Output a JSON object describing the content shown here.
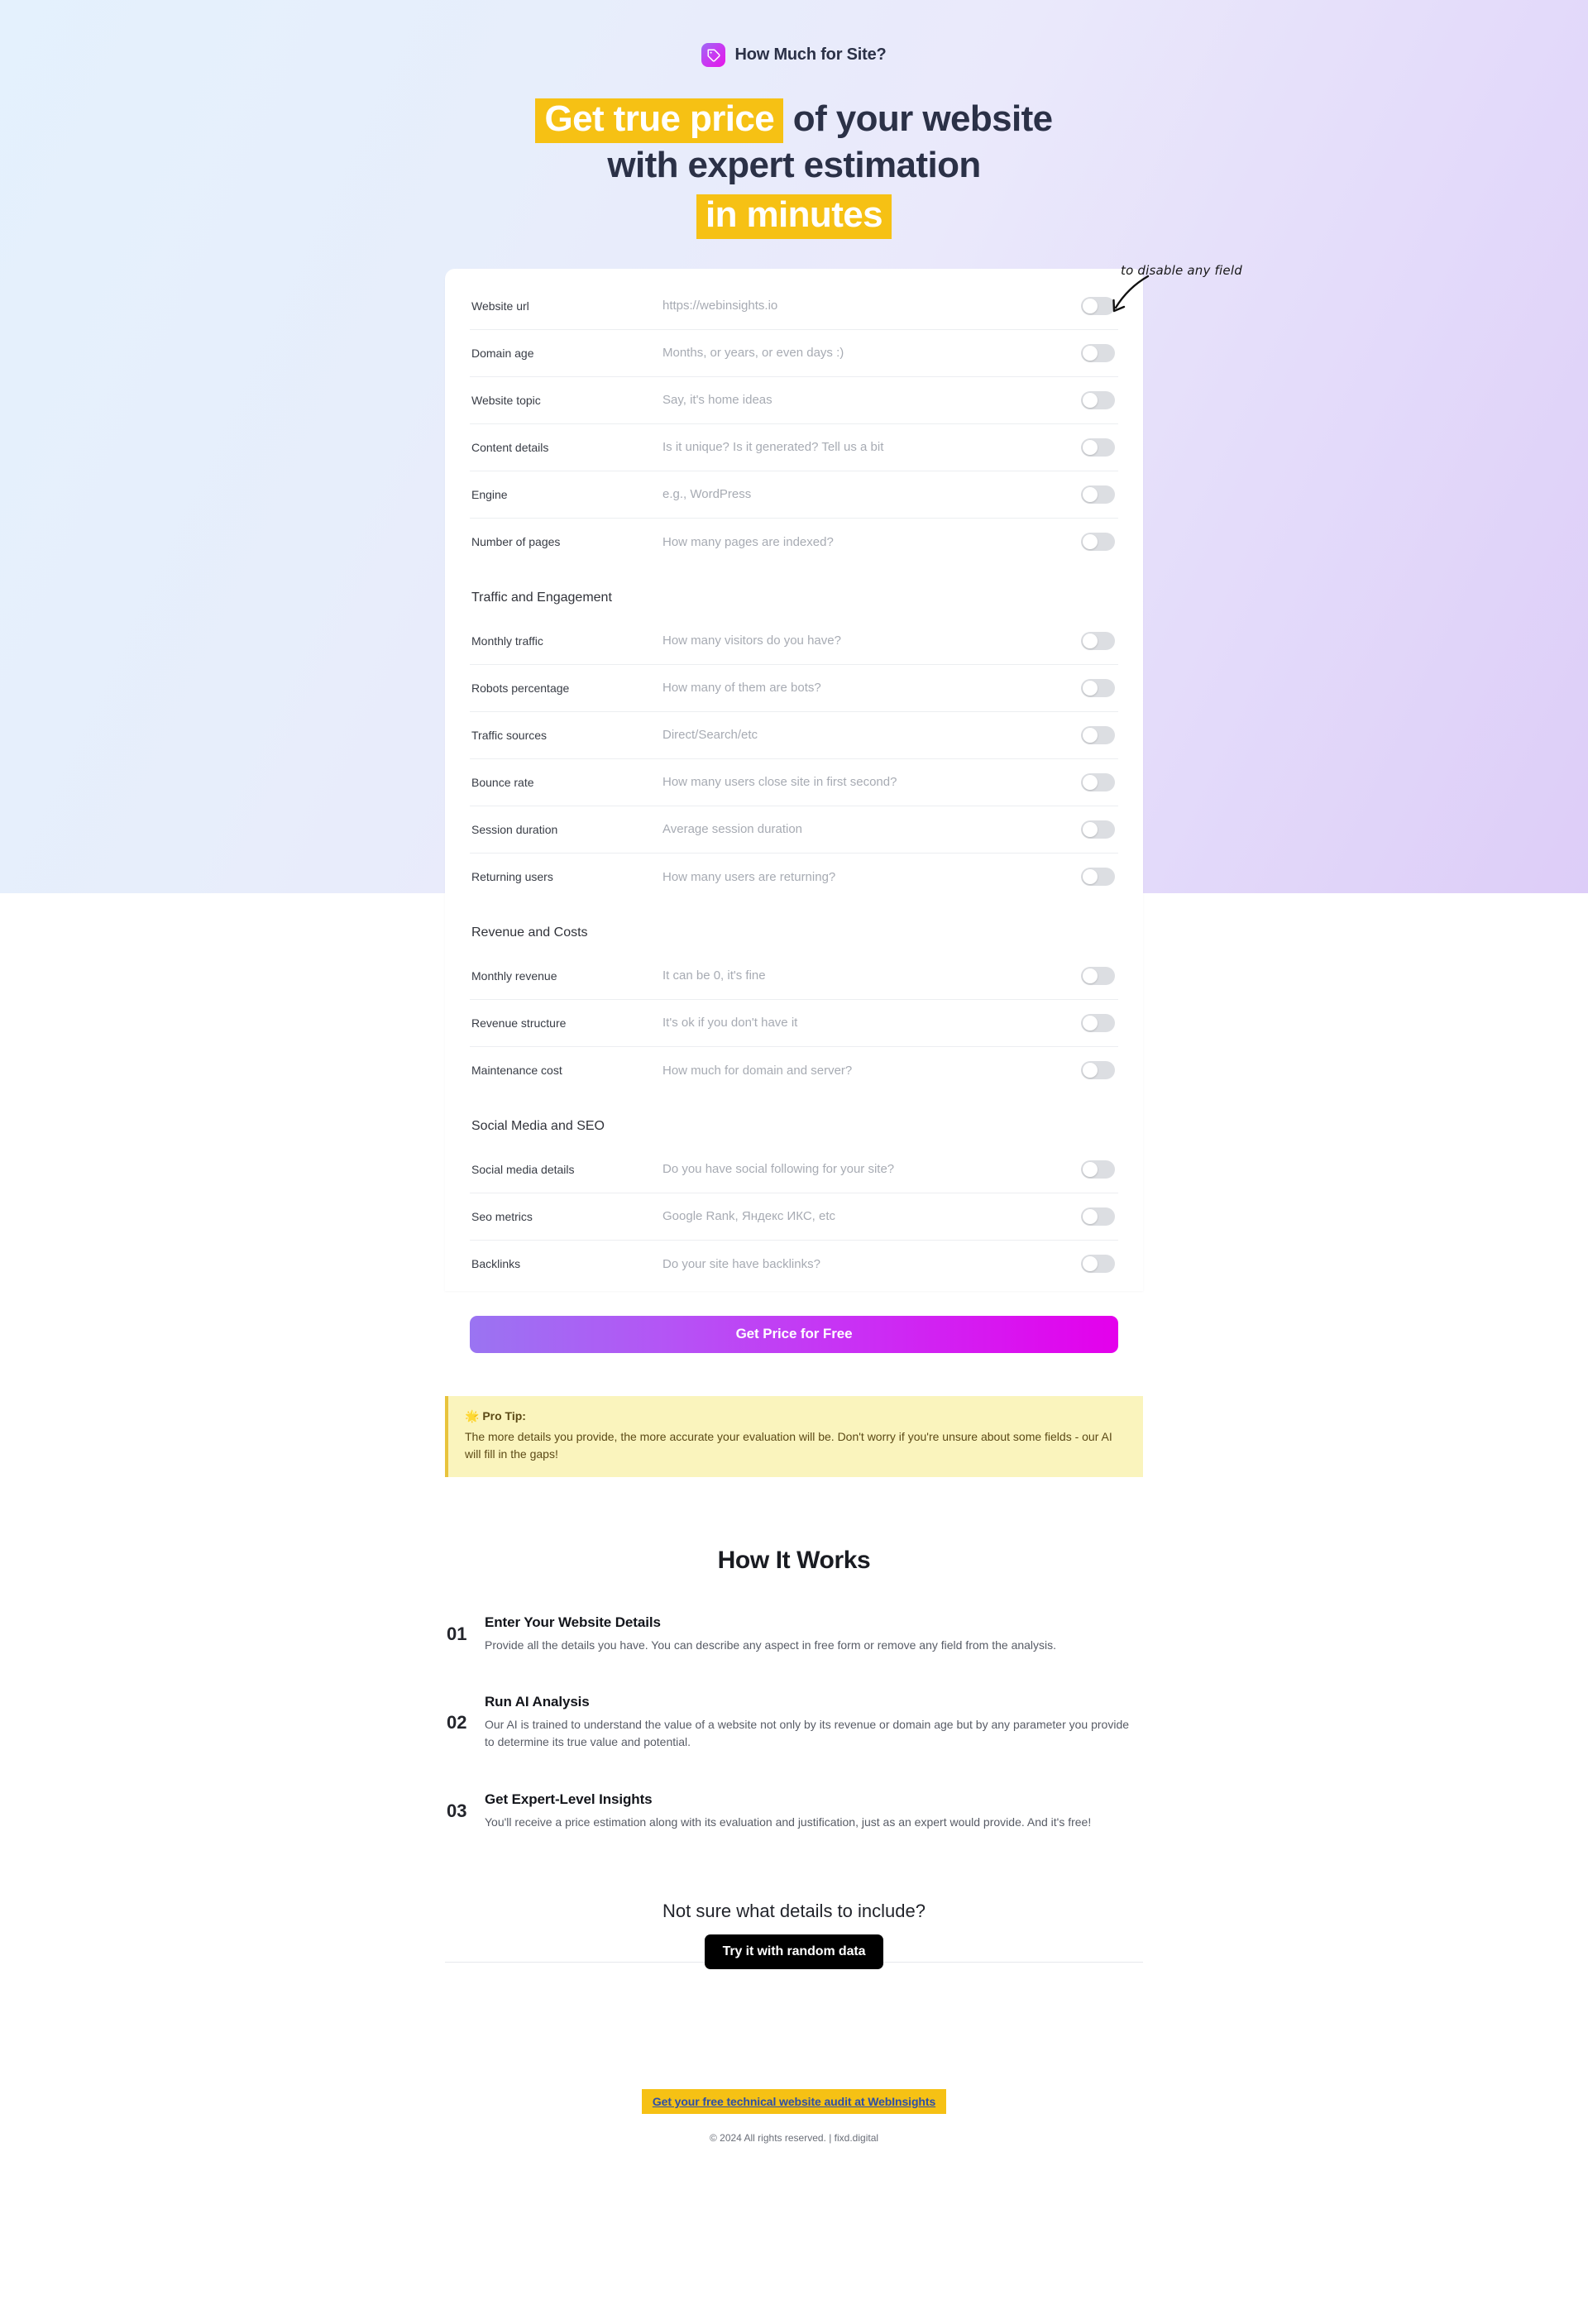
{
  "brand": {
    "name": "How Much for Site?",
    "logo_icon": "price-tag-icon"
  },
  "headline": {
    "part1": "Get true price",
    "part2": " of your website",
    "line2": "with expert estimation",
    "part3": "in minutes"
  },
  "annotation": {
    "text": "to disable any field",
    "icon": "curved-arrow-icon"
  },
  "form": {
    "groups": [
      {
        "title": "",
        "fields": [
          {
            "label": "Website url",
            "placeholder": "https://webinsights.io",
            "enabled": false
          },
          {
            "label": "Domain age",
            "placeholder": "Months, or years, or even days :)",
            "enabled": false
          },
          {
            "label": "Website topic",
            "placeholder": "Say, it's home ideas",
            "enabled": false
          },
          {
            "label": "Content details",
            "placeholder": "Is it unique? Is it generated? Tell us a bit",
            "enabled": false
          },
          {
            "label": "Engine",
            "placeholder": "e.g., WordPress",
            "enabled": false
          },
          {
            "label": "Number of pages",
            "placeholder": "How many pages are indexed?",
            "enabled": false
          }
        ]
      },
      {
        "title": "Traffic and Engagement",
        "fields": [
          {
            "label": "Monthly traffic",
            "placeholder": "How many visitors do you have?",
            "enabled": false
          },
          {
            "label": "Robots percentage",
            "placeholder": "How many of them are bots?",
            "enabled": false
          },
          {
            "label": "Traffic sources",
            "placeholder": "Direct/Search/etc",
            "enabled": false
          },
          {
            "label": "Bounce rate",
            "placeholder": "How many users close site in first second?",
            "enabled": false
          },
          {
            "label": "Session duration",
            "placeholder": "Average session duration",
            "enabled": false
          },
          {
            "label": "Returning users",
            "placeholder": "How many users are returning?",
            "enabled": false
          }
        ]
      },
      {
        "title": "Revenue and Costs",
        "fields": [
          {
            "label": "Monthly revenue",
            "placeholder": "It can be 0, it's fine",
            "enabled": false
          },
          {
            "label": "Revenue structure",
            "placeholder": "It's ok if you don't have it",
            "enabled": false
          },
          {
            "label": "Maintenance cost",
            "placeholder": "How much for domain and server?",
            "enabled": false
          }
        ]
      },
      {
        "title": "Social Media and SEO",
        "fields": [
          {
            "label": "Social media details",
            "placeholder": "Do you have social following for your site?",
            "enabled": false
          },
          {
            "label": "Seo metrics",
            "placeholder": "Google Rank, Яндекс ИКС, etc",
            "enabled": false
          },
          {
            "label": "Backlinks",
            "placeholder": "Do your site have backlinks?",
            "enabled": false
          }
        ]
      }
    ],
    "submit_label": "Get Price for Free"
  },
  "protip": {
    "icon": "sparkle-star-icon",
    "title": "Pro Tip:",
    "body": "The more details you provide, the more accurate your evaluation will be. Don't worry if you're unsure about some fields - our AI will fill in the gaps!"
  },
  "how_it_works": {
    "title": "How It Works",
    "steps": [
      {
        "num": "01",
        "heading": "Enter Your Website Details",
        "text": "Provide all the details you have. You can describe any aspect in free form or remove any field from the analysis."
      },
      {
        "num": "02",
        "heading": "Run AI Analysis",
        "text": "Our AI is trained to understand the value of a website not only by its revenue or domain age but by any parameter you provide to determine its true value and potential."
      },
      {
        "num": "03",
        "heading": "Get Expert-Level Insights",
        "text": "You'll receive a price estimation along with its evaluation and justification, just as an expert would provide. And it's free!"
      }
    ]
  },
  "bottom_cta": {
    "question": "Not sure what details to include?",
    "button_label": "Try it with random data"
  },
  "footer": {
    "audit_banner": "Get your free technical website audit at WebInsights",
    "copyright": "© 2024 All rights reserved. | fixd.digital"
  },
  "colors": {
    "accent_yellow": "#f6c114",
    "brand_gradient_start": "#9a74f2",
    "brand_gradient_end": "#e400ec",
    "heading_dark": "#2b3147",
    "protip_bg": "#faf4bd",
    "footer_link_blue": "#2b4ea8"
  }
}
